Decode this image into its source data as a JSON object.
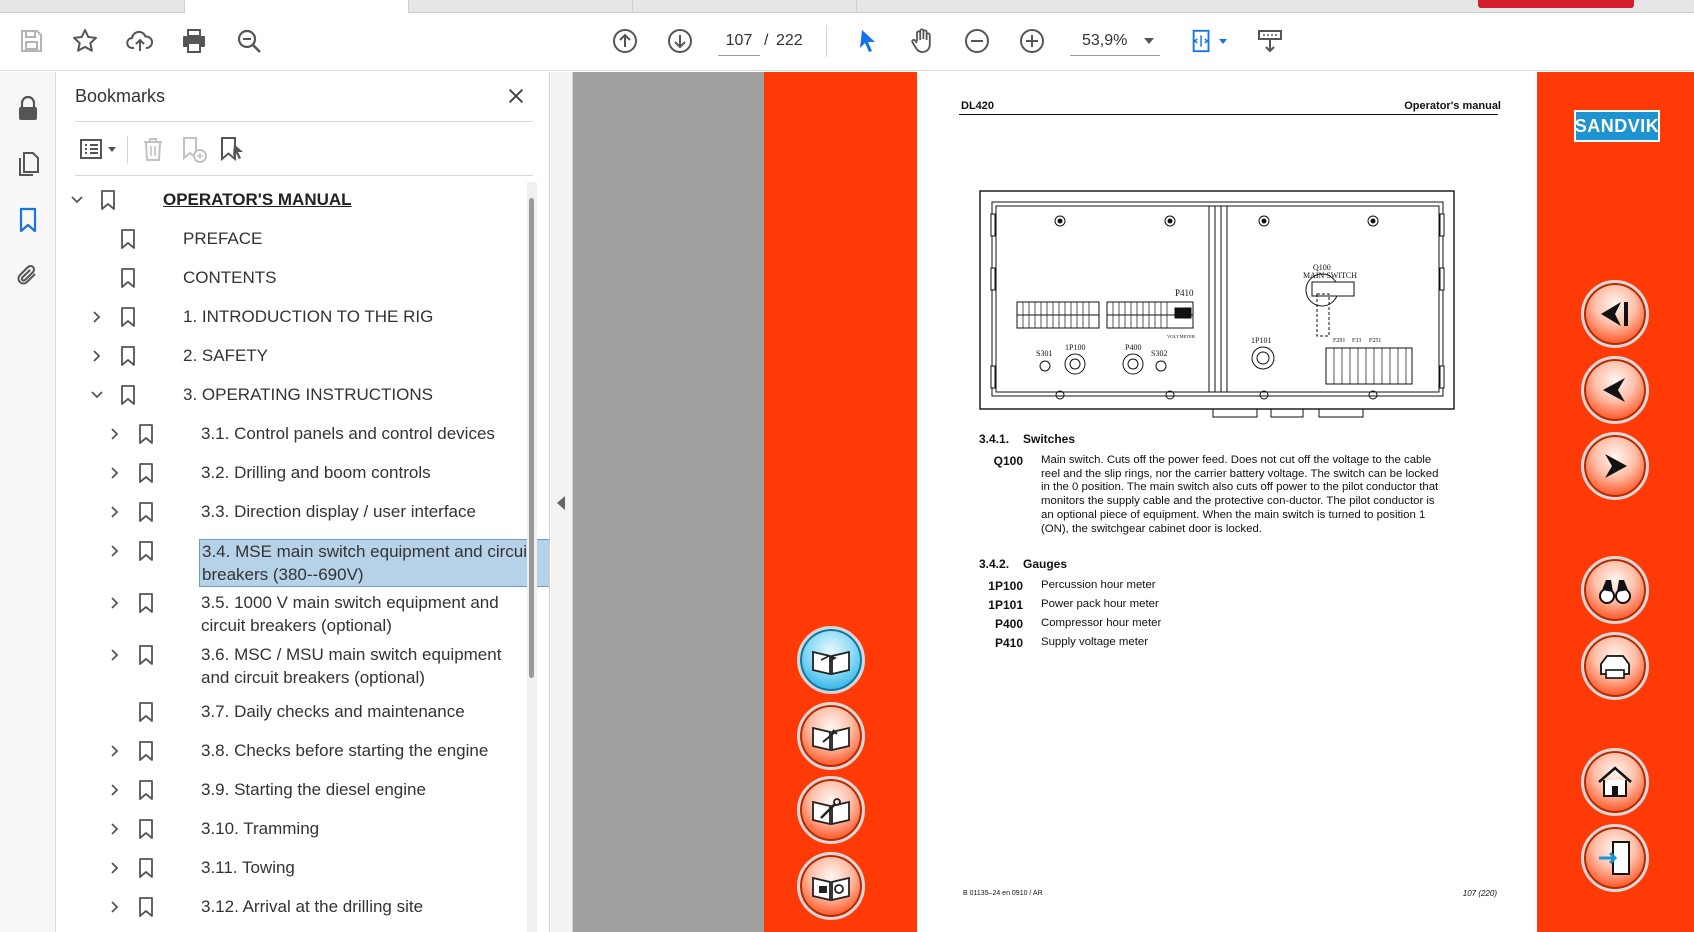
{
  "toolbar": {
    "current_page": "107",
    "page_separator": "/",
    "total_pages": "222",
    "zoom": "53,9%"
  },
  "bookmarks": {
    "title": "Bookmarks",
    "items": [
      {
        "label": "OPERATOR'S MANUAL",
        "level": 0,
        "expander": "expanded"
      },
      {
        "label": "PREFACE",
        "level": 1,
        "expander": "none"
      },
      {
        "label": "CONTENTS",
        "level": 1,
        "expander": "none"
      },
      {
        "label": "1. INTRODUCTION TO THE RIG",
        "level": 1,
        "expander": "collapsed"
      },
      {
        "label": "2. SAFETY",
        "level": 1,
        "expander": "collapsed"
      },
      {
        "label": "3. OPERATING INSTRUCTIONS",
        "level": 1,
        "expander": "expanded"
      },
      {
        "label": "3.1. Control panels and control devices",
        "level": 2,
        "expander": "collapsed"
      },
      {
        "label": "3.2. Drilling and boom controls",
        "level": 2,
        "expander": "collapsed"
      },
      {
        "label": "3.3. Direction display / user interface",
        "level": 2,
        "expander": "collapsed"
      },
      {
        "label": "3.4. MSE main switch equipment and circuit breakers (380--690V)",
        "level": 2,
        "expander": "collapsed",
        "selected": true
      },
      {
        "label": "3.5. 1000 V main switch equipment and circuit breakers (optional)",
        "level": 2,
        "expander": "collapsed"
      },
      {
        "label": "3.6. MSC / MSU main switch equipment and circuit breakers (optional)",
        "level": 2,
        "expander": "collapsed"
      },
      {
        "label": "3.7. Daily checks and maintenance",
        "level": 2,
        "expander": "none"
      },
      {
        "label": "3.8. Checks before starting the engine",
        "level": 2,
        "expander": "collapsed"
      },
      {
        "label": "3.9. Starting the diesel engine",
        "level": 2,
        "expander": "collapsed"
      },
      {
        "label": "3.10. Tramming",
        "level": 2,
        "expander": "collapsed"
      },
      {
        "label": "3.11. Towing",
        "level": 2,
        "expander": "collapsed"
      },
      {
        "label": "3.12. Arrival at the drilling site",
        "level": 2,
        "expander": "collapsed"
      }
    ]
  },
  "document": {
    "header_left": "DL420",
    "header_right": "Operator's manual",
    "brand": "SANDVIK",
    "figure_labels": {
      "q100": "Q100",
      "main_switch": "MAIN SWITCH",
      "p410": "P410",
      "volt_meter": "VOLT METER",
      "s301": "S301",
      "p100": "1P100",
      "p400": "P400",
      "s302": "S302",
      "p101": "1P101",
      "f291": "F291",
      "f33": "F33",
      "f251": "F251"
    },
    "section_1": {
      "number": "3.4.1.",
      "title": "Switches"
    },
    "switches": [
      {
        "code": "Q100",
        "text": "Main switch. Cuts off the power feed. Does not cut off the voltage to the cable reel and the slip rings, nor the carrier battery voltage. The switch can be locked in the 0 position.  The main switch also cuts off power to the pilot conductor that monitors the supply cable and the protective con-ductor. The pilot conductor is an optional piece of equipment. When the main switch is turned to position 1 (ON), the switchgear cabinet door is locked."
      }
    ],
    "section_2": {
      "number": "3.4.2.",
      "title": "Gauges"
    },
    "gauges": [
      {
        "code": "1P100",
        "text": "Percussion hour meter"
      },
      {
        "code": "1P101",
        "text": "Power pack hour meter"
      },
      {
        "code": "P400",
        "text": "Compressor hour meter"
      },
      {
        "code": "P410",
        "text": "Supply voltage meter"
      }
    ],
    "footer_left": "B 01135–24 en 0910 / AR",
    "footer_right": "107 (220)"
  },
  "colors": {
    "accent_orange": "#ff3a06",
    "selection_blue": "#b6d2e8",
    "acrobat_blue": "#1473e6",
    "sandvik_blue": "#1d93d2"
  }
}
